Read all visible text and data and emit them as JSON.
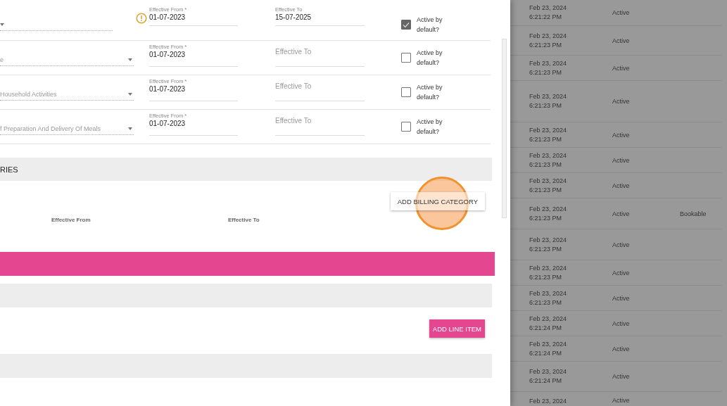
{
  "form_rows": [
    {
      "warning": true,
      "effective_from_label": "Effective From *",
      "effective_from": "01-07-2023",
      "effective_to_label": "Effective To",
      "effective_to": "15-07-2025",
      "active_label": "Active by default?",
      "checked": true
    },
    {
      "category": "e",
      "warning": false,
      "effective_from_label": "Effective From *",
      "effective_from": "01-07-2023",
      "effective_to_placeholder": "Effective To",
      "active_label": "Active by default?",
      "checked": false
    },
    {
      "category": "Household Activities",
      "warning": false,
      "effective_from_label": "Effective From *",
      "effective_from": "01-07-2023",
      "effective_to_placeholder": "Effective To",
      "active_label": "Active by default?",
      "checked": false
    },
    {
      "category": "f Preparation And Delivery Of Meals",
      "warning": false,
      "effective_from_label": "Effective From *",
      "effective_from": "01-07-2023",
      "effective_to_placeholder": "Effective To",
      "active_label": "Active by default?",
      "checked": false
    }
  ],
  "billing_section": {
    "title": "RIES",
    "button": "ADD BILLING CATEGORY",
    "columns": [
      "Effective From",
      "Effective To"
    ]
  },
  "line_items": {
    "button": "ADD LINE ITEM"
  },
  "background_table": {
    "rows": [
      {
        "date": "Feb 23, 2024",
        "time": "6:21:22 PM",
        "status": "Active"
      },
      {
        "date": "Feb 23, 2024",
        "time": "6:21:23 PM",
        "status": "Active"
      },
      {
        "date": "Feb 23, 2024",
        "time": "6:21:23 PM",
        "status": "Active"
      },
      {
        "date": "Feb 23, 2024",
        "time": "6:21:23 PM",
        "status": "Active"
      },
      {
        "date": "Feb 23, 2024",
        "time": "6:21:23 PM",
        "status": "Active"
      },
      {
        "date": "Feb 23, 2024",
        "time": "6:21:23 PM",
        "status": "Active"
      },
      {
        "date": "Feb 23, 2024",
        "time": "6:21:23 PM",
        "status": "Active"
      },
      {
        "date": "Feb 23, 2024",
        "time": "6:21:23 PM",
        "status": "Active",
        "column_3": "Bookable"
      },
      {
        "date": "Feb 23, 2024",
        "time": "6:21:23 PM",
        "status": "Active"
      },
      {
        "date": "Feb 23, 2024",
        "time": "6:21:23 PM",
        "status": "Active"
      },
      {
        "date": "Feb 23, 2024",
        "time": "6:21:23 PM",
        "status": "Active"
      },
      {
        "date": "Feb 23, 2024",
        "time": "6:21:24 PM",
        "status": "Active"
      },
      {
        "date": "Feb 23, 2024",
        "time": "6:21:24 PM",
        "status": "Active"
      },
      {
        "date": "Feb 23, 2024",
        "time": "6:21:24 PM",
        "status": "Active"
      },
      {
        "date": "Feb 23, 2024",
        "status": "Active"
      }
    ]
  }
}
